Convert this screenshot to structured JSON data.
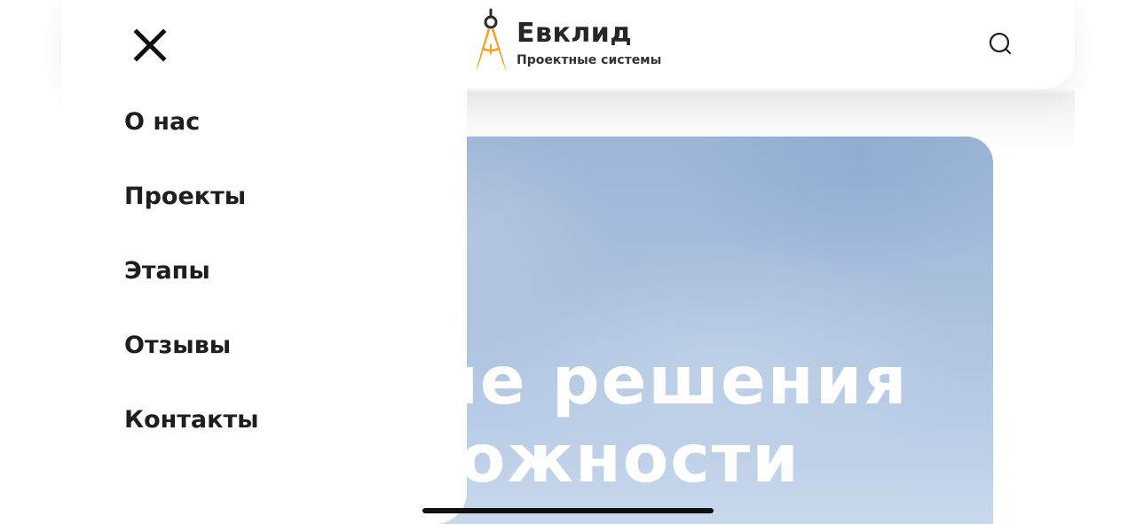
{
  "header": {
    "logo_name": "Евклид",
    "logo_subtitle": "Проектные системы",
    "logo_icon": "compass-icon",
    "search_icon": "search-icon",
    "logo_accent": "#f4a11d"
  },
  "menu": {
    "close_icon": "close-icon",
    "items": [
      {
        "label": "О нас"
      },
      {
        "label": "Проекты"
      },
      {
        "label": "Этапы"
      },
      {
        "label": "Отзывы"
      },
      {
        "label": "Контакты"
      }
    ]
  },
  "hero": {
    "line1": "Проектные решения",
    "line2": "любой сложности"
  },
  "colors": {
    "text": "#1e1e1e",
    "hero_sky": "#a9c0dd",
    "background": "#ffffff"
  }
}
